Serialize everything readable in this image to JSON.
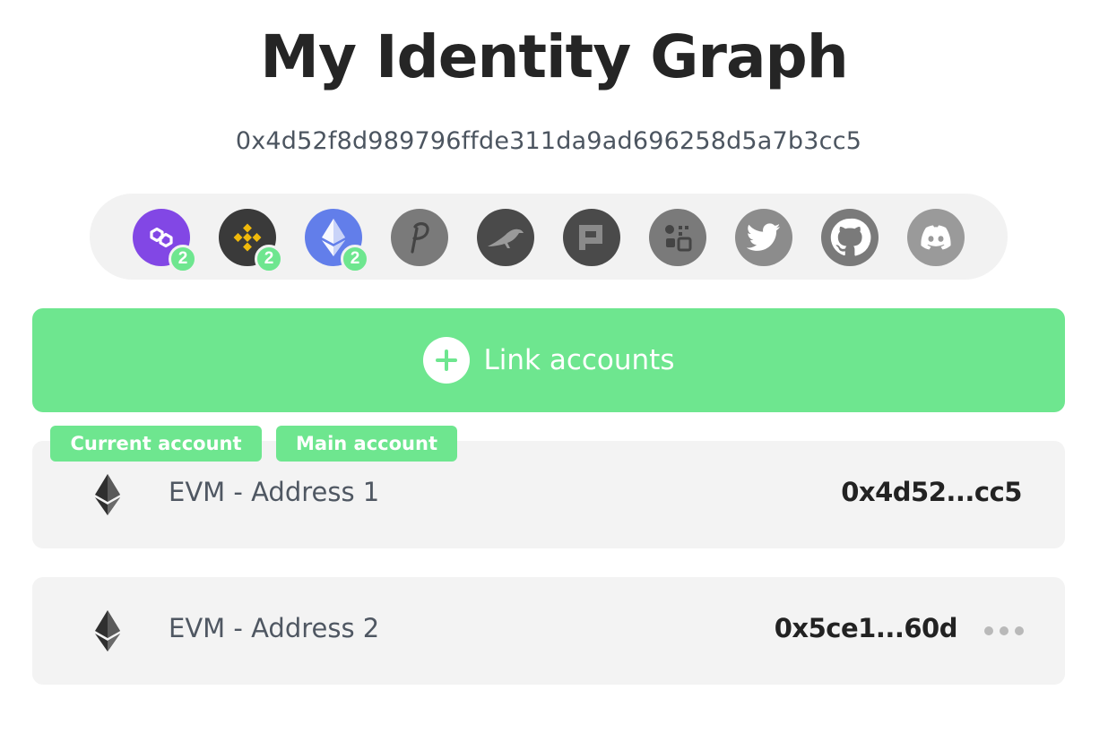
{
  "page": {
    "title": "My Identity Graph",
    "address": "0x4d52f8d989796ffde311da9ad696258d5a7b3cc5"
  },
  "networks": [
    {
      "icon": "polygon-icon",
      "count": "2",
      "color": "#8247e5"
    },
    {
      "icon": "binance-icon",
      "count": "2",
      "color": "#3a3a3a"
    },
    {
      "icon": "ethereum-icon",
      "count": "2",
      "color": "#627eea"
    },
    {
      "icon": "polkadot-icon",
      "count": "",
      "color": "#7a7a7a"
    },
    {
      "icon": "crow-icon",
      "count": "",
      "color": "#4a4a4a"
    },
    {
      "icon": "pixel-p-icon",
      "count": "",
      "color": "#4a4a4a"
    },
    {
      "icon": "qr-icon",
      "count": "",
      "color": "#7a7a7a"
    },
    {
      "icon": "twitter-icon",
      "count": "",
      "color": "#8c8c8c"
    },
    {
      "icon": "github-icon",
      "count": "",
      "color": "#7a7a7a"
    },
    {
      "icon": "discord-icon",
      "count": "",
      "color": "#9a9a9a"
    }
  ],
  "link_button": {
    "label": "Link accounts",
    "color": "#6ee68f"
  },
  "tags": {
    "current": "Current account",
    "main": "Main account"
  },
  "accounts": [
    {
      "name": "EVM - Address 1",
      "address": "0x4d52...cc5"
    },
    {
      "name": "EVM - Address 2",
      "address": "0x5ce1...60d"
    }
  ]
}
